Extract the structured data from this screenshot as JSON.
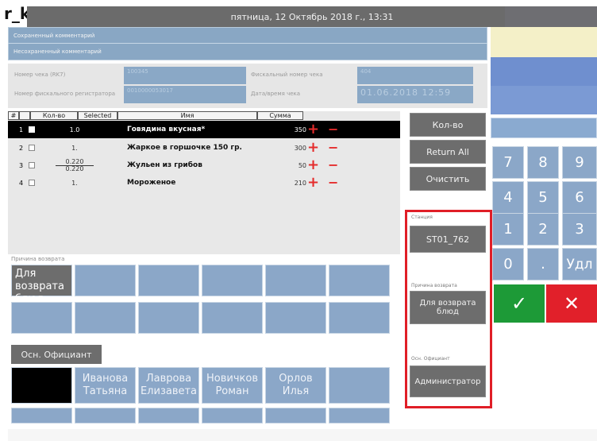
{
  "app": {
    "logo": "r_k",
    "datetime": "пятница, 12 Октябрь 2018 г., 13:31"
  },
  "comments": {
    "saved": "Сохраненный комментарий",
    "unsaved": "Несохраненный комментарий"
  },
  "receipt": {
    "check_number_label": "Номер чека (RK7)",
    "check_number_value": "100345",
    "fiscal_reg_label": "Номер фискального регистратора",
    "fiscal_reg_value": "0010000053017",
    "fiscal_check_label": "Фискальный номер чека",
    "fiscal_check_value": "404",
    "datetime_label": "Дата/время чека",
    "datetime_value": "01.06.2018 12:59"
  },
  "table": {
    "headers": [
      "#",
      "Кол-во",
      "Selected",
      "Имя",
      "Сумма"
    ],
    "rows": [
      {
        "num": "1",
        "qty": "1.0",
        "name": "Говядина вкусная*",
        "sum": "350",
        "selected": true
      },
      {
        "num": "2",
        "qty": "1.",
        "name": "Жаркое в горшочке 150 гр.",
        "sum": "300",
        "selected": false
      },
      {
        "num": "3",
        "qty_top": "0.220",
        "qty_bottom": "0.220",
        "name": "Жульен из грибов",
        "sum": "50",
        "selected": false
      },
      {
        "num": "4",
        "qty": "1.",
        "name": "Мороженое",
        "sum": "210",
        "selected": false
      }
    ],
    "plus_icon": "plus-icon",
    "minus_icon": "minus-icon"
  },
  "actions": {
    "qty": "Кол-во",
    "return_all": "Return All",
    "clear": "Очистить"
  },
  "highlight": {
    "station_label": "Станция",
    "station_value": "ST01_762",
    "reason_label": "Причина возврата",
    "reason_value": "Для возврата блюд",
    "waiter_label": "Осн. Официант",
    "waiter_value": "Администратор",
    "frame_color": "#e01e27"
  },
  "reason_section": {
    "label": "Причина возврата",
    "first_tile": "Для возврата блюд"
  },
  "waiters": {
    "tab": "Осн. Официант",
    "list": [
      "Иванова Татьяна",
      "Лаврова Елизавета",
      "Новичков Роман",
      "Орлов Илья"
    ]
  },
  "numpad": {
    "keys": [
      "7",
      "8",
      "9",
      "4",
      "5",
      "6",
      "1",
      "2",
      "3",
      "0",
      ".",
      "Удл"
    ],
    "ok_icon": "check-icon",
    "cancel_icon": "x-icon"
  },
  "colors": {
    "tile_blue": "#8ba7c8",
    "button_grey": "#6d6d6d",
    "ok_green": "#1d9a37",
    "cancel_red": "#e1202a"
  }
}
